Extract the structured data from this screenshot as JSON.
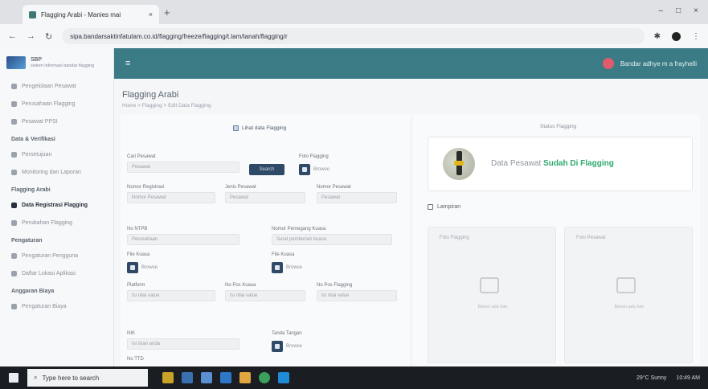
{
  "browser": {
    "tab_title": "Flagging Arabi - Manies mai",
    "url": "sipa.bandarsaktinfatutam.co.id/flagging/freeze/flagging/t.lam/tanah/flagging/r",
    "controls": {
      "back": "←",
      "forward": "→",
      "reload": "↻",
      "new_tab": "+",
      "tab_close": "×",
      "minimize": "–",
      "maximize": "□",
      "close": "×",
      "extensions": "✱",
      "menu": "⋮"
    }
  },
  "app": {
    "brand": {
      "title": "SBP",
      "subtitle": "sistem informasi bandar flagging"
    },
    "header": {
      "menu": "≡",
      "user_name": "Bandar adhye m a frayhelli"
    },
    "sidebar": {
      "items_top": [
        "Pengelolaan Pesawat",
        "Perusahaan Flagging",
        "Pesawat PPSI"
      ],
      "section1": "Data & Verifikasi",
      "items_section1": [
        "Persetujuan",
        "Monitoring dan Laporan"
      ],
      "section2": "Flagging Arabi",
      "items_section2": [
        {
          "label": "Data Registrasi Flagging",
          "active": true
        },
        {
          "label": "Perubahan Flagging",
          "active": false
        }
      ],
      "section3": "Pengaturan",
      "items_section3": [
        "Pengaturan Pengguna",
        "Daftar Lokasi Aplikasi"
      ],
      "section4": "Anggaran Biaya",
      "items_section4": [
        "Pengaturan Biaya"
      ]
    },
    "page": {
      "title": "Flagging Arabi",
      "breadcrumb": "Home > Flagging > Edit Data Flagging",
      "checkbox_label": "Lihat data Flagging",
      "form": {
        "f1": {
          "label": "Cari Pesawat",
          "value": "Pesawat"
        },
        "search_button": "Search",
        "f2": {
          "label": "Foto Flagging",
          "file": "Browse"
        },
        "f3": {
          "label": "Nomor Registrasi",
          "value": "Nomor Pesawat"
        },
        "f4": {
          "label": "Jenis Pesawat",
          "value": "Pesawat"
        },
        "f5": {
          "label": "Nomor Pesawat",
          "value": "Pesawat"
        },
        "f6": {
          "label": "No NTPB",
          "value": "Perusahaan"
        },
        "f7": {
          "label": "Nomor Pemegang Kuasa",
          "value": "Surat pemberian kuasa"
        },
        "f8": {
          "label": "File Kuasa",
          "file": "Browse"
        },
        "f9": {
          "label": "File Kuasa",
          "file": "Browse"
        },
        "f10": {
          "label": "Platform",
          "value": "Isi nilai value"
        },
        "f11": {
          "label": "No Pos Kuasa",
          "value": "Isi nilai value"
        },
        "f12": {
          "label": "No Pos Flagging",
          "value": "Isi nilai value"
        },
        "f13": {
          "label": "NIK",
          "value": "Isi isian anda"
        },
        "f14": {
          "label": "Tanda Tangan",
          "file": "Browse"
        },
        "f15": {
          "label": "No TTD"
        }
      },
      "status": {
        "label": "Status Flagging",
        "text_prefix": "Data Pesawat",
        "text_highlight": "Sudah Di Flagging"
      },
      "lampiran": {
        "title": "Lampiran",
        "cards": [
          {
            "title": "Foto Flagging",
            "placeholder": "Belum ada foto"
          },
          {
            "title": "Foto Pesawat",
            "placeholder": "Belum ada foto"
          }
        ]
      }
    }
  },
  "taskbar": {
    "search_placeholder": "Type here to search",
    "tray_text": "29°C  Sunny",
    "clock": "10:49 AM"
  }
}
